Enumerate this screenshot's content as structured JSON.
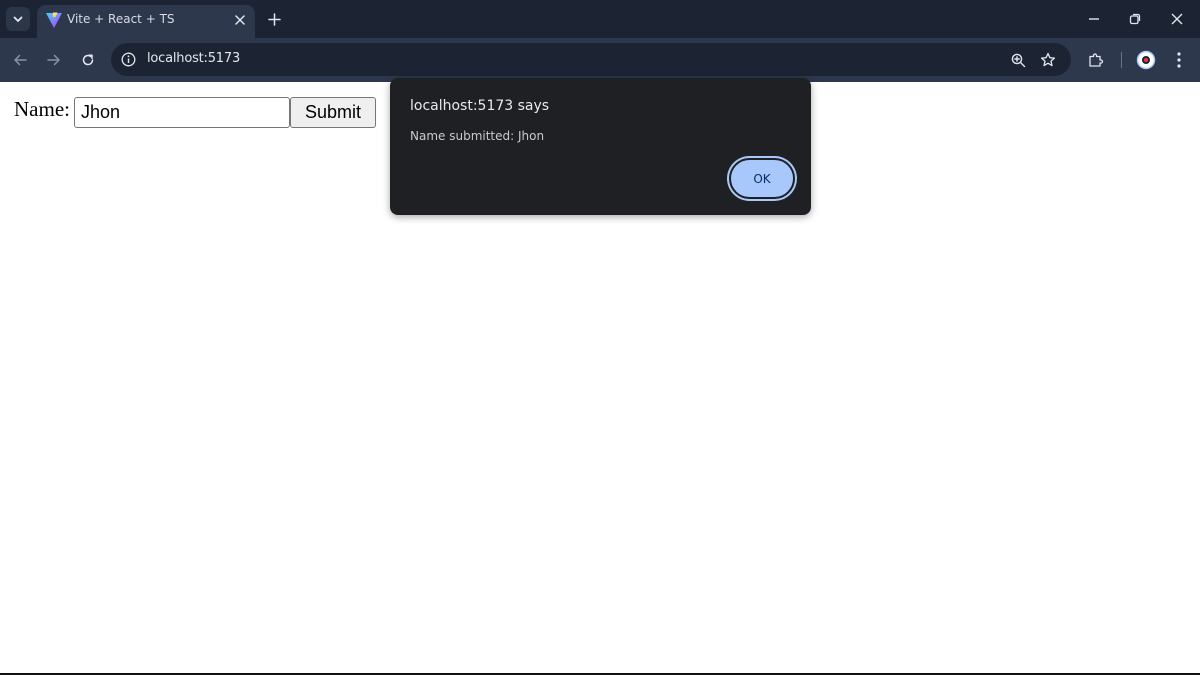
{
  "browser": {
    "tab": {
      "title": "Vite + React + TS"
    },
    "new_tab_glyph": "+",
    "url": "localhost:5173",
    "colors": {
      "frame": "#1c2434",
      "toolbar": "#2d384d",
      "icon": "#c4cad6"
    }
  },
  "page": {
    "name_label": "Name:",
    "name_value": "Jhon",
    "submit_label": "Submit"
  },
  "dialog": {
    "title": "localhost:5173 says",
    "message": "Name submitted: Jhon",
    "ok_label": "OK",
    "colors": {
      "background": "#1f2024",
      "ok_button": "#a8c7fa"
    }
  }
}
